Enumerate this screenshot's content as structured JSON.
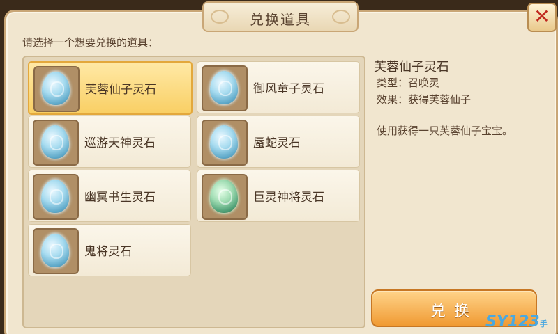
{
  "dialog": {
    "title": "兑换道具",
    "close_glyph": "✕"
  },
  "prompt": "请选择一个想要兑换的道具：",
  "items": [
    {
      "label": "芙蓉仙子灵石",
      "icon": "spirit-stone-icon",
      "selected": true
    },
    {
      "label": "御风童子灵石",
      "icon": "spirit-stone-icon",
      "selected": false
    },
    {
      "label": "巡游天神灵石",
      "icon": "spirit-stone-icon",
      "selected": false
    },
    {
      "label": "蜃蛇灵石",
      "icon": "spirit-stone-icon",
      "selected": false
    },
    {
      "label": "幽冥书生灵石",
      "icon": "spirit-stone-icon",
      "selected": false
    },
    {
      "label": "巨灵神将灵石",
      "icon": "spirit-stone-green-icon",
      "selected": false
    },
    {
      "label": "鬼将灵石",
      "icon": "spirit-stone-icon",
      "selected": false
    }
  ],
  "detail": {
    "name": "芙蓉仙子灵石",
    "type_row": "类型：召唤灵",
    "effect_row": "效果：获得芙蓉仙子",
    "description": "使用获得一只芙蓉仙子宝宝。"
  },
  "exchange_button": "兑换",
  "watermark": {
    "text": "SY123",
    "suffix": "手游.net"
  },
  "colors": {
    "selected_bg": "#f9cf64",
    "button": "#f09a33",
    "close_x": "#c0281e"
  }
}
